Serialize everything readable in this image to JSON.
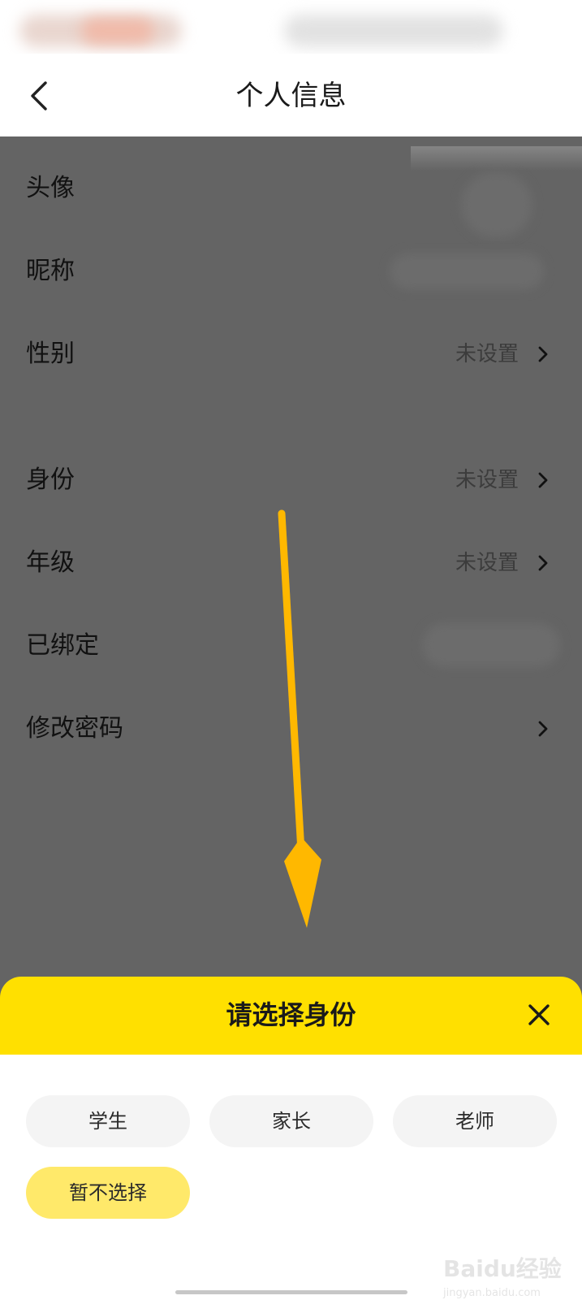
{
  "header": {
    "title": "个人信息",
    "back_icon": "chevron-left-icon"
  },
  "profile_rows": [
    {
      "label": "头像",
      "value": ""
    },
    {
      "label": "昵称",
      "value": ""
    },
    {
      "label": "性别",
      "value": "未设置"
    },
    {
      "label": "身份",
      "value": "未设置"
    },
    {
      "label": "年级",
      "value": "未设置"
    },
    {
      "label": "已绑定",
      "value": ""
    },
    {
      "label": "修改密码",
      "value": ""
    }
  ],
  "sheet": {
    "title": "请选择身份",
    "close_icon": "close-icon",
    "options": [
      "学生",
      "家长",
      "老师",
      "暂不选择"
    ],
    "selected": "暂不选择"
  },
  "watermark": {
    "text": "Baidu经验",
    "sub": "jingyan.baidu.com"
  },
  "colors": {
    "accent": "#ffe000",
    "selected_option": "#ffe96a",
    "overlay": "#646464",
    "arrow": "#ffb800"
  }
}
